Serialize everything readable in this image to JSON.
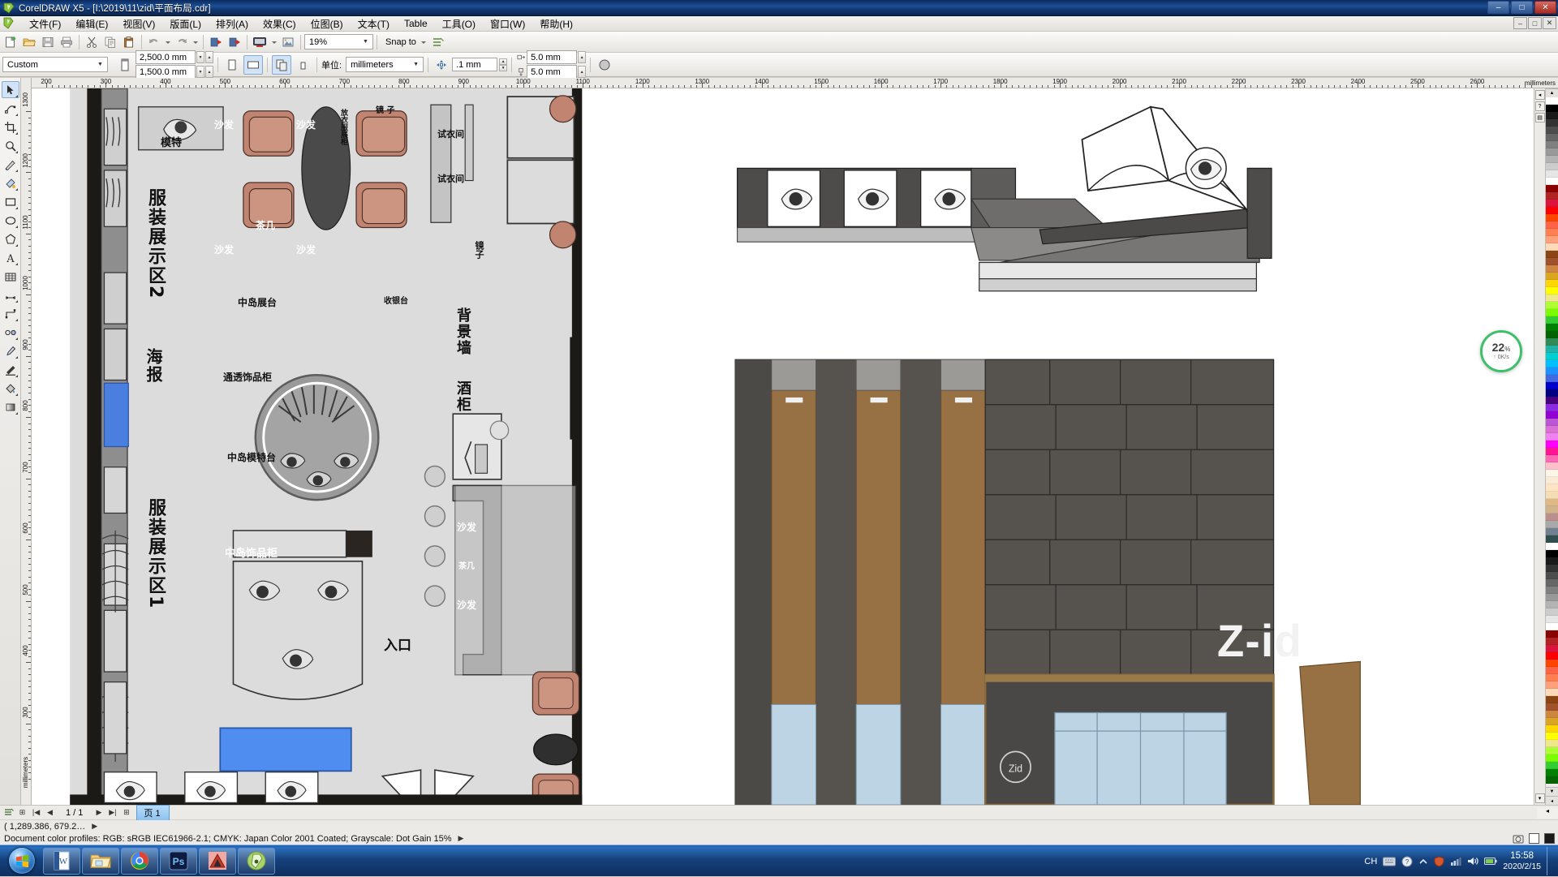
{
  "window": {
    "title": "CorelDRAW X5 - [I:\\2019\\11\\zid\\平面布局.cdr]",
    "minimize": "–",
    "maximize": "□",
    "close": "✕",
    "doc_minimize": "–",
    "doc_maximize": "□",
    "doc_close": "✕"
  },
  "menubar": {
    "items": [
      {
        "label": "文件(F)",
        "name": "menu-file"
      },
      {
        "label": "编辑(E)",
        "name": "menu-edit"
      },
      {
        "label": "视图(V)",
        "name": "menu-view"
      },
      {
        "label": "版面(L)",
        "name": "menu-layout"
      },
      {
        "label": "排列(A)",
        "name": "menu-arrange"
      },
      {
        "label": "效果(C)",
        "name": "menu-effects"
      },
      {
        "label": "位图(B)",
        "name": "menu-bitmaps"
      },
      {
        "label": "文本(T)",
        "name": "menu-text"
      },
      {
        "label": "Table",
        "name": "menu-table"
      },
      {
        "label": "工具(O)",
        "name": "menu-tools"
      },
      {
        "label": "窗口(W)",
        "name": "menu-window"
      },
      {
        "label": "帮助(H)",
        "name": "menu-help"
      }
    ]
  },
  "toolbar": {
    "zoom_level": "19%",
    "snap_label": "Snap to",
    "icons": [
      "new-document-icon",
      "open-folder-icon",
      "save-icon",
      "print-icon",
      "cut-scissors-icon",
      "copy-icon",
      "paste-icon",
      "undo-icon",
      "redo-icon",
      "import-icon",
      "export-icon",
      "application-launcher-icon",
      "bitmap-icon"
    ]
  },
  "propertybar": {
    "paper_type": "Custom",
    "page_width": "2,500.0 mm",
    "page_height": "1,500.0 mm",
    "units_label": "单位:",
    "units_value": "millimeters",
    "nudge_value": ".1 mm",
    "duplicate_x": "5.0 mm",
    "duplicate_y": "5.0 mm"
  },
  "rulers": {
    "unit_label": "millimeters",
    "corner_label": "mm",
    "vertical_unit_label": "millimeters",
    "h_ticks": [
      "200",
      "300",
      "400",
      "500",
      "600",
      "700",
      "800",
      "900",
      "1000",
      "1100",
      "1200",
      "1300",
      "1400",
      "1500",
      "1600",
      "1700",
      "1800",
      "1900",
      "2000",
      "2100",
      "2200",
      "2300",
      "2400",
      "2500",
      "2600"
    ],
    "v_ticks": [
      "1300",
      "1200",
      "1100",
      "1000",
      "900",
      "800",
      "700",
      "600",
      "500",
      "400",
      "300"
    ]
  },
  "toolbox": {
    "tools": [
      {
        "name": "pick-tool",
        "glyph": "pick"
      },
      {
        "name": "shape-tool",
        "glyph": "shape"
      },
      {
        "name": "crop-tool",
        "glyph": "crop"
      },
      {
        "name": "zoom-tool",
        "glyph": "zoom"
      },
      {
        "name": "freehand-tool",
        "glyph": "pen"
      },
      {
        "name": "smart-fill-tool",
        "glyph": "smart"
      },
      {
        "name": "rectangle-tool",
        "glyph": "rect"
      },
      {
        "name": "ellipse-tool",
        "glyph": "ellipse"
      },
      {
        "name": "polygon-tool",
        "glyph": "poly"
      },
      {
        "name": "text-tool",
        "glyph": "text"
      },
      {
        "name": "table-tool",
        "glyph": "table"
      },
      {
        "name": "dimension-tool",
        "glyph": "dim"
      },
      {
        "name": "connector-tool",
        "glyph": "conn"
      },
      {
        "name": "blend-tool",
        "glyph": "blend"
      },
      {
        "name": "color-eyedropper-tool",
        "glyph": "drop"
      },
      {
        "name": "outline-tool",
        "glyph": "outline"
      },
      {
        "name": "fill-tool",
        "glyph": "fill"
      },
      {
        "name": "interactive-fill-tool",
        "glyph": "ifill"
      }
    ]
  },
  "drawing": {
    "floorplan": {
      "labels": {
        "model": "模特",
        "sofa": "沙发",
        "tea_table": "茶几",
        "clothes_cabinet": "放衣服展柜",
        "mirror_top": "镜 子",
        "fitting_room_1": "试衣间",
        "fitting_room_2": "试衣间",
        "display_area_2": "服装展示区2",
        "poster": "海报",
        "center_display": "中岛展台",
        "mirror_right": "镜子",
        "cashier": "收银台",
        "background_wall": "背景墙",
        "wine_cabinet": "酒柜",
        "transparent_cabinet": "通透饰品柜",
        "center_model_stand": "中岛模特台",
        "display_area_1": "服装展示区1",
        "island_accessory_cabinet": "中岛饰品柜",
        "entrance": "入口"
      },
      "colors": {
        "sofa_fill": "#c89684",
        "floor_fill": "#dddddd",
        "wall_fill": "#1c1a17",
        "poster_fill": "#4a7fe0",
        "blue_box_fill": "#4f8ef0",
        "tea_table_fill": "#4a4a4a",
        "cabinet_grey": "#8a8a8a"
      }
    },
    "elevation": {
      "logo_text": "Z-id",
      "badge_text": "Zid",
      "colors": {
        "dark_grey": "#555353",
        "mid_grey": "#6f6d6b",
        "wood_brown": "#977044",
        "glass_blue": "#bcd4e3",
        "panel_grey": "#4a4846"
      }
    }
  },
  "downloader": {
    "percent": "22",
    "percent_symbol": "%",
    "speed": "0K/s",
    "arrow": "↑",
    "ring_color": "#3ebf6a"
  },
  "pagenav": {
    "first": "|◀",
    "prev": "◀",
    "counter": "1 / 1",
    "next": "▶",
    "last": "▶|",
    "add_before": "⊞",
    "add_after": "⊞",
    "options": "☰",
    "page_tab": "页 1"
  },
  "status": {
    "coordinates": "( 1,289.386, 679.2…",
    "color_profiles": "Document color profiles: RGB: sRGB IEC61966-2.1; CMYK: Japan Color 2001 Coated; Grayscale: Dot Gain 15%",
    "expand_arrow": "▶"
  },
  "taskbar": {
    "start_name": "start-orb",
    "apps": [
      {
        "name": "taskbar-word",
        "label": "W"
      },
      {
        "name": "taskbar-explorer",
        "label": ""
      },
      {
        "name": "taskbar-chrome",
        "label": ""
      },
      {
        "name": "taskbar-photoshop",
        "label": "Ps"
      },
      {
        "name": "taskbar-autocad",
        "label": "A"
      },
      {
        "name": "taskbar-coreldraw",
        "label": ""
      }
    ],
    "tray": {
      "ime": "CH",
      "time": "15:58",
      "date": "2020/2/15"
    }
  }
}
